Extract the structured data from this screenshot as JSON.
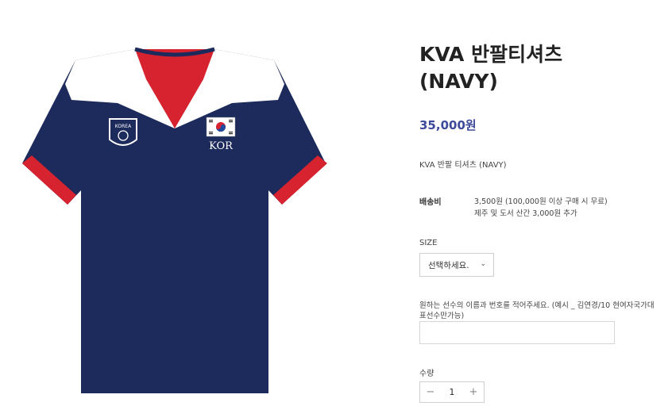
{
  "product": {
    "title_line1": "KVA 반팔티셔츠",
    "title_line2": "(NAVY)",
    "price": "35,000원",
    "summary": "KVA 반팔 티셔츠 (NAVY)"
  },
  "shirt": {
    "badge_text": "KOREA",
    "country_code": "KOR",
    "colors": {
      "navy": "#1d2a5c",
      "red": "#d7232f",
      "white": "#ffffff"
    }
  },
  "shipping": {
    "label": "배송비",
    "line1": "3,500원 (100,000원 이상 구매 시 무료)",
    "line2": "제주 및 도서 산간 3,000원 추가"
  },
  "size": {
    "label": "SIZE",
    "selected": "선택하세요."
  },
  "custom": {
    "label": "원하는 선수의 이름과 번호를 적어주세요. (예시 _ 김연경/10 현여자국가대표선수만가능)",
    "value": ""
  },
  "quantity": {
    "label": "수량",
    "minus": "−",
    "plus": "+",
    "value": "1"
  },
  "accent": "#3d4a9a"
}
